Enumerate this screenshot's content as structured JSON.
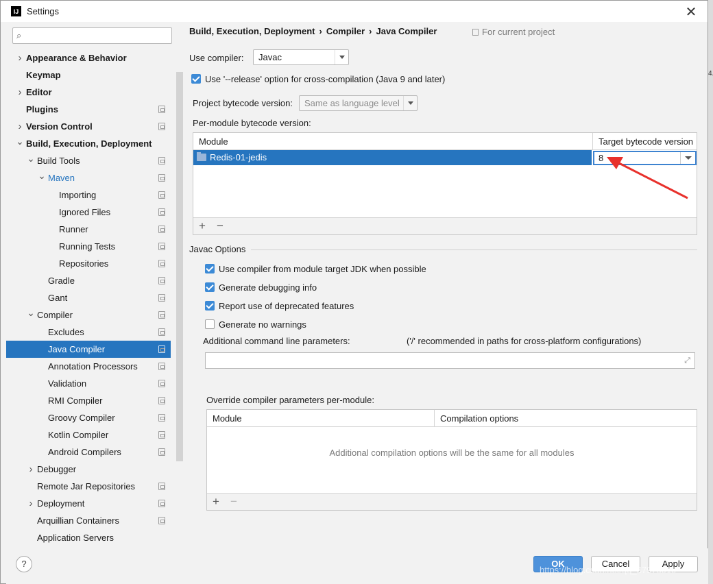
{
  "window": {
    "title": "Settings",
    "app_icon_text": "IJ"
  },
  "search": {
    "placeholder": ""
  },
  "sidebar": {
    "items": [
      {
        "label": "Appearance & Behavior",
        "level": 0,
        "arrow": "right",
        "bold": true,
        "proj": false
      },
      {
        "label": "Keymap",
        "level": 0,
        "arrow": "",
        "bold": true,
        "proj": false
      },
      {
        "label": "Editor",
        "level": 0,
        "arrow": "right",
        "bold": true,
        "proj": false
      },
      {
        "label": "Plugins",
        "level": 0,
        "arrow": "",
        "bold": true,
        "proj": true
      },
      {
        "label": "Version Control",
        "level": 0,
        "arrow": "right",
        "bold": true,
        "proj": true
      },
      {
        "label": "Build, Execution, Deployment",
        "level": 0,
        "arrow": "down",
        "bold": true,
        "proj": false
      },
      {
        "label": "Build Tools",
        "level": 1,
        "arrow": "down",
        "bold": false,
        "proj": true
      },
      {
        "label": "Maven",
        "level": 2,
        "arrow": "down",
        "bold": false,
        "blue": true,
        "proj": true
      },
      {
        "label": "Importing",
        "level": 3,
        "arrow": "",
        "bold": false,
        "proj": true
      },
      {
        "label": "Ignored Files",
        "level": 3,
        "arrow": "",
        "bold": false,
        "proj": true
      },
      {
        "label": "Runner",
        "level": 3,
        "arrow": "",
        "bold": false,
        "proj": true
      },
      {
        "label": "Running Tests",
        "level": 3,
        "arrow": "",
        "bold": false,
        "proj": true
      },
      {
        "label": "Repositories",
        "level": 3,
        "arrow": "",
        "bold": false,
        "proj": true
      },
      {
        "label": "Gradle",
        "level": 2,
        "arrow": "",
        "bold": false,
        "proj": true
      },
      {
        "label": "Gant",
        "level": 2,
        "arrow": "",
        "bold": false,
        "proj": true
      },
      {
        "label": "Compiler",
        "level": 1,
        "arrow": "down",
        "bold": false,
        "proj": true
      },
      {
        "label": "Excludes",
        "level": 2,
        "arrow": "",
        "bold": false,
        "proj": true
      },
      {
        "label": "Java Compiler",
        "level": 2,
        "arrow": "",
        "bold": false,
        "proj": true,
        "selected": true
      },
      {
        "label": "Annotation Processors",
        "level": 2,
        "arrow": "",
        "bold": false,
        "proj": true
      },
      {
        "label": "Validation",
        "level": 2,
        "arrow": "",
        "bold": false,
        "proj": true
      },
      {
        "label": "RMI Compiler",
        "level": 2,
        "arrow": "",
        "bold": false,
        "proj": true
      },
      {
        "label": "Groovy Compiler",
        "level": 2,
        "arrow": "",
        "bold": false,
        "proj": true
      },
      {
        "label": "Kotlin Compiler",
        "level": 2,
        "arrow": "",
        "bold": false,
        "proj": true
      },
      {
        "label": "Android Compilers",
        "level": 2,
        "arrow": "",
        "bold": false,
        "proj": true
      },
      {
        "label": "Debugger",
        "level": 1,
        "arrow": "right",
        "bold": false,
        "proj": false
      },
      {
        "label": "Remote Jar Repositories",
        "level": 1,
        "arrow": "",
        "bold": false,
        "proj": true
      },
      {
        "label": "Deployment",
        "level": 1,
        "arrow": "right",
        "bold": false,
        "proj": true
      },
      {
        "label": "Arquillian Containers",
        "level": 1,
        "arrow": "",
        "bold": false,
        "proj": true
      },
      {
        "label": "Application Servers",
        "level": 1,
        "arrow": "",
        "bold": false,
        "proj": false
      }
    ]
  },
  "breadcrumb": {
    "part1": "Build, Execution, Deployment",
    "part2": "Compiler",
    "part3": "Java Compiler",
    "sep": "›"
  },
  "for_project": "For current project",
  "use_compiler": {
    "label": "Use compiler:",
    "value": "Javac"
  },
  "release_option": {
    "label": "Use '--release' option for cross-compilation (Java 9 and later)",
    "checked": true
  },
  "project_bytecode": {
    "label": "Project bytecode version:",
    "value": "Same as language level"
  },
  "per_module": {
    "label": "Per-module bytecode version:",
    "col_module": "Module",
    "col_target": "Target bytecode version",
    "row_module": "Redis-01-jedis",
    "row_target": "8",
    "add": "+",
    "remove": "−"
  },
  "javac": {
    "section": "Javac Options",
    "opt1": {
      "label": "Use compiler from module target JDK when possible",
      "checked": true
    },
    "opt2": {
      "label": "Generate debugging info",
      "checked": true
    },
    "opt3": {
      "label": "Report use of deprecated features",
      "checked": true
    },
    "opt4": {
      "label": "Generate no warnings",
      "checked": false
    },
    "cmd_label": "Additional command line parameters:",
    "cmd_hint": "('/' recommended in paths for cross-platform configurations)",
    "cmd_value": ""
  },
  "override": {
    "label": "Override compiler parameters per-module:",
    "col_module": "Module",
    "col_options": "Compilation options",
    "empty": "Additional compilation options will be the same for all modules",
    "add": "+",
    "remove": "−"
  },
  "footer": {
    "help": "?",
    "ok": "OK",
    "cancel": "Cancel",
    "apply": "Apply"
  },
  "watermark": "https://blog.csdn.net/qq_37975919",
  "edge_text": "4."
}
